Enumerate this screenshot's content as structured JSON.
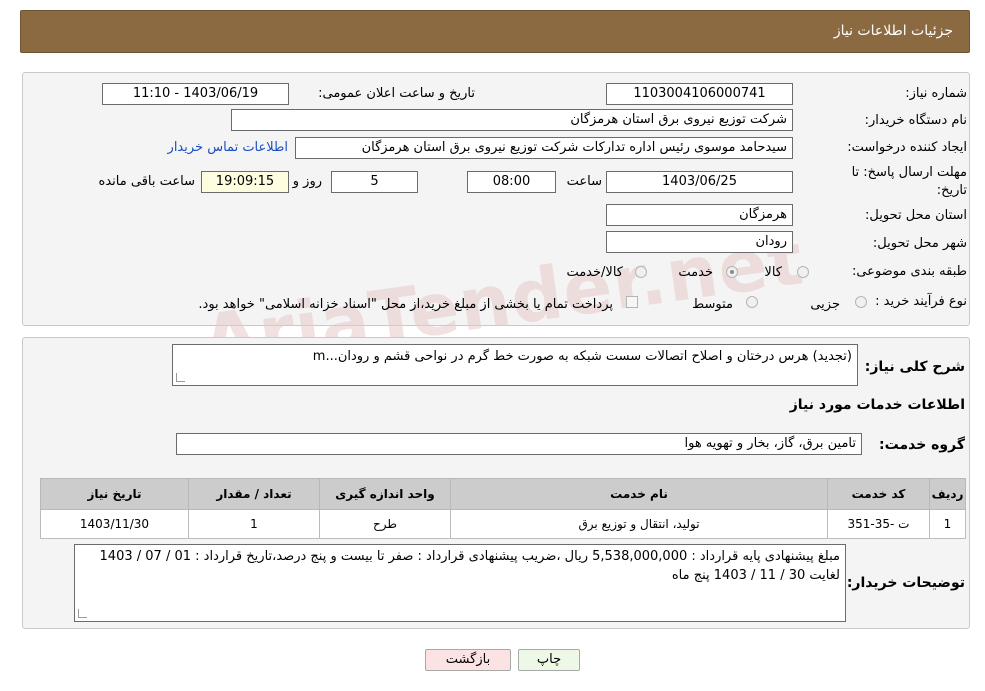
{
  "header": {
    "title": "جزئیات اطلاعات نیاز"
  },
  "info": {
    "need_number_label": "شماره نیاز:",
    "need_number": "1103004106000741",
    "announce_label": "تاریخ و ساعت اعلان عمومی:",
    "announce_value": "1403/06/19 - 11:10",
    "buyer_org_label": "نام دستگاه خریدار:",
    "buyer_org": "شرکت توزیع نیروی برق استان هرمزگان",
    "requester_label": "ایجاد کننده درخواست:",
    "requester": "سیدحامد موسوی رئیس اداره تدارکات شرکت توزیع نیروی برق استان هرمزگان",
    "contact_link": "اطلاعات تماس خریدار",
    "deadline_label_1": "مهلت ارسال پاسخ: تا",
    "deadline_label_2": "تاریخ:",
    "deadline_date": "1403/06/25",
    "time_label": "ساعت",
    "deadline_time": "08:00",
    "days_value": "5",
    "days_label": "روز و",
    "remaining_time": "19:09:15",
    "remaining_label": "ساعت باقی مانده",
    "province_label": "استان محل تحویل:",
    "province": "هرمزگان",
    "city_label": "شهر محل تحویل:",
    "city": "رودان",
    "category_label": "طبقه بندی موضوعی:",
    "category_options": [
      "کالا",
      "خدمت",
      "کالا/خدمت"
    ],
    "category_selected": "خدمت",
    "process_label": "نوع فرآیند خرید :",
    "process_options": [
      "جزیی",
      "متوسط"
    ],
    "payment_note": "پرداخت تمام یا بخشی از مبلغ خرید،از محل \"اسناد خزانه اسلامی\" خواهد بود."
  },
  "details": {
    "summary_label": "شرح کلی نیاز:",
    "summary": "(تجدید) هرس درختان و اصلاح اتصالات سست شبکه به صورت خط گرم در نواحی قشم و رودان...m",
    "services_title": "اطلاعات خدمات مورد نیاز",
    "group_label": "گروه خدمت:",
    "group_value": "تامین برق، گاز، بخار و تهویه هوا",
    "table": {
      "headers": [
        "ردیف",
        "کد خدمت",
        "نام خدمت",
        "واحد اندازه گیری",
        "تعداد / مقدار",
        "تاریخ نیاز"
      ],
      "rows": [
        [
          "1",
          "ت -35-351",
          "تولید، انتقال و توزیع برق",
          "طرح",
          "1",
          "1403/11/30"
        ]
      ]
    },
    "notes_label": "توضیحات خریدار:",
    "notes": "مبلغ پیشنهادی پایه قرارداد : 5,538,000,000 ریال ،ضریب پیشنهادی قرارداد : صفر تا بیست و پنج درصد،تاریخ قرارداد : 01 / 07 / 1403 لغایت 30 / 11 / 1403 پنج ماه"
  },
  "buttons": {
    "print": "چاپ",
    "back": "بازگشت"
  },
  "watermark": "AriaTender.net"
}
